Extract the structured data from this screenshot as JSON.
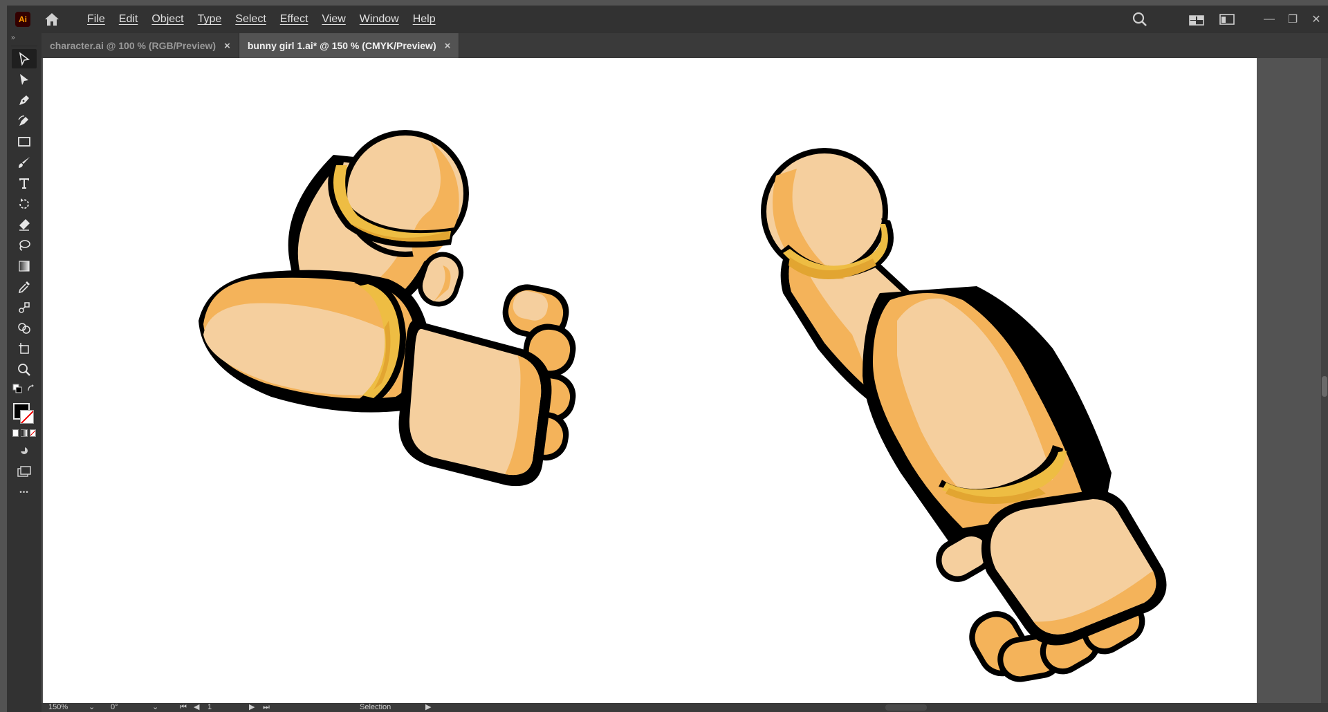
{
  "app": {
    "logo_text": "Ai"
  },
  "menu": {
    "items": [
      "File",
      "Edit",
      "Object",
      "Type",
      "Select",
      "Effect",
      "View",
      "Window",
      "Help"
    ]
  },
  "tabs": [
    {
      "label": "character.ai @ 100 % (RGB/Preview)",
      "active": false
    },
    {
      "label": "bunny girl 1.ai* @ 150 % (CMYK/Preview)",
      "active": true
    }
  ],
  "tab_close_glyph": "×",
  "toolbar": {
    "collapse_glyph": "››",
    "more_glyph": "•••",
    "tools": [
      "selection-tool-icon",
      "direct-selection-tool-icon",
      "pen-tool-icon",
      "curvature-tool-icon",
      "rectangle-tool-icon",
      "paintbrush-tool-icon",
      "type-tool-icon",
      "rotate-tool-icon",
      "eraser-tool-icon",
      "lasso-tool-icon",
      "gradient-tool-icon",
      "eyedropper-tool-icon",
      "blend-tool-icon",
      "shape-builder-tool-icon",
      "artboard-tool-icon",
      "zoom-tool-icon"
    ]
  },
  "status": {
    "zoom": "150%",
    "rotation": "0°",
    "artboard_number": "1",
    "mode": "Selection"
  },
  "window_controls": {
    "minimize": "—",
    "restore": "❐",
    "close": "✕"
  },
  "colors": {
    "skin_light": "#f5cf9e",
    "skin_shadow": "#f4b35a",
    "band": "#eebd43",
    "band_dark": "#e2a531",
    "outline": "#000000"
  }
}
